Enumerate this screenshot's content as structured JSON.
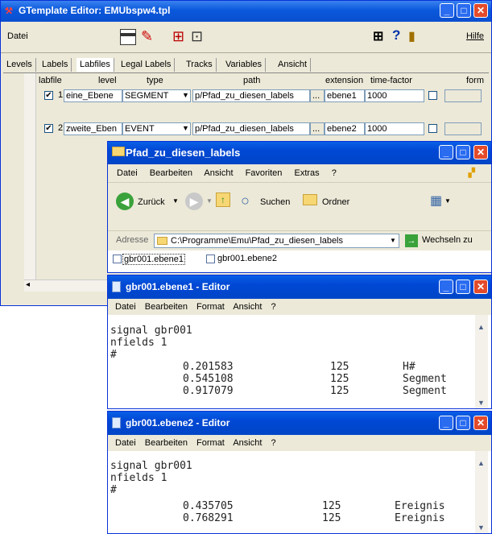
{
  "gtemplate": {
    "title": "GTemplate Editor: EMUbspw4.tpl",
    "menu_left": "Datei",
    "menu_right": "Hilfe",
    "tabs": [
      "Levels",
      "Labels",
      "Labfiles",
      "Legal Labels",
      "Tracks",
      "Variables",
      "Ansicht"
    ],
    "active_tab": "Labfiles",
    "columns": [
      "labfile",
      "level",
      "type",
      "path",
      "extension",
      "time-factor",
      "form"
    ],
    "rows": [
      {
        "num": "1",
        "level": "eine_Ebene",
        "type": "SEGMENT",
        "path": "p/Pfad_zu_diesen_labels",
        "browse": "...",
        "extension": "ebene1",
        "time_factor": "1000"
      },
      {
        "num": "2",
        "level": "zweite_Eben",
        "type": "EVENT",
        "path": "p/Pfad_zu_diesen_labels",
        "browse": "...",
        "extension": "ebene2",
        "time_factor": "1000"
      }
    ]
  },
  "explorer": {
    "title": "Pfad_zu_diesen_labels",
    "menu": [
      "Datei",
      "Bearbeiten",
      "Ansicht",
      "Favoriten",
      "Extras",
      "?"
    ],
    "back_label": "Zurück",
    "search_label": "Suchen",
    "folders_label": "Ordner",
    "address_label": "Adresse",
    "address_value": "C:\\Programme\\Emu\\Pfad_zu_diesen_labels",
    "go_label": "Wechseln zu",
    "files": [
      "gbr001.ebene1",
      "gbr001.ebene2"
    ]
  },
  "editor1": {
    "title": "gbr001.ebene1 - Editor",
    "menu": [
      "Datei",
      "Bearbeiten",
      "Format",
      "Ansicht",
      "?"
    ],
    "lines": [
      "signal gbr001",
      "nfields 1",
      "#"
    ],
    "data": [
      [
        "0.201583",
        "125",
        "H#"
      ],
      [
        "0.545108",
        "125",
        "Segment"
      ],
      [
        "0.917079",
        "125",
        "Segment"
      ]
    ]
  },
  "editor2": {
    "title": "gbr001.ebene2 - Editor",
    "menu": [
      "Datei",
      "Bearbeiten",
      "Format",
      "Ansicht",
      "?"
    ],
    "lines": [
      "signal gbr001",
      "nfields 1",
      "#"
    ],
    "data": [
      [
        "0.435705",
        "125",
        "Ereignis"
      ],
      [
        "0.768291",
        "125",
        "Ereignis"
      ]
    ]
  }
}
